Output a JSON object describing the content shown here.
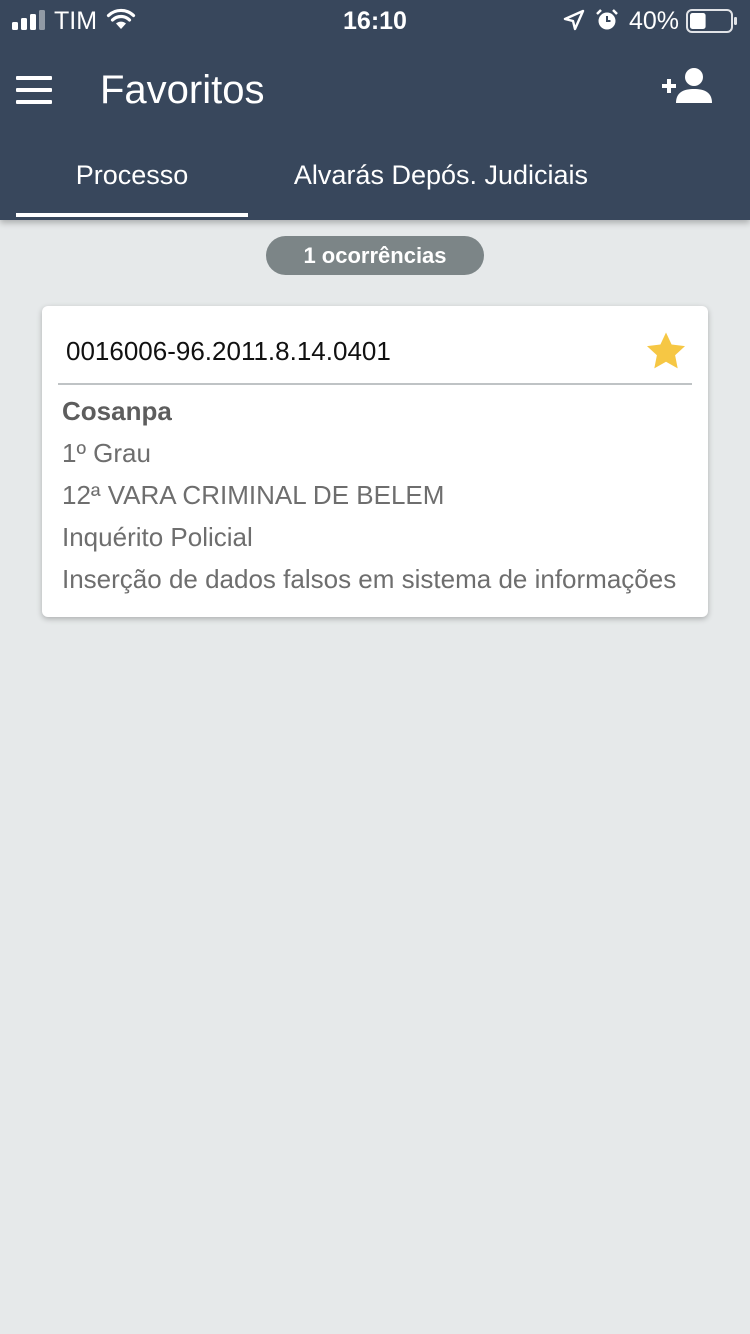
{
  "status_bar": {
    "carrier": "TIM",
    "time": "16:10",
    "battery_percent": "40%",
    "battery_level": 0.4,
    "icons": [
      "signal-icon",
      "wifi-icon",
      "location-icon",
      "alarm-icon",
      "battery-icon"
    ]
  },
  "app_bar": {
    "title": "Favoritos",
    "icons": [
      "menu-icon",
      "add-user-icon"
    ]
  },
  "tabs": [
    {
      "label": "Processo",
      "active": true
    },
    {
      "label": "Alvarás Depós. Judiciais",
      "active": false
    }
  ],
  "results": {
    "count_label": "1 ocorrências"
  },
  "cards": [
    {
      "process_number": "0016006-96.2011.8.14.0401",
      "favorite": true,
      "party": "Cosanpa",
      "degree": "1º Grau",
      "court": "12ª VARA CRIMINAL DE BELEM",
      "class": "Inquérito Policial",
      "subject": "Inserção de dados falsos em sistema de informações"
    }
  ],
  "colors": {
    "header": "#38475c",
    "background": "#e6e9ea",
    "pill": "#7c8587",
    "star": "#f6c744"
  }
}
